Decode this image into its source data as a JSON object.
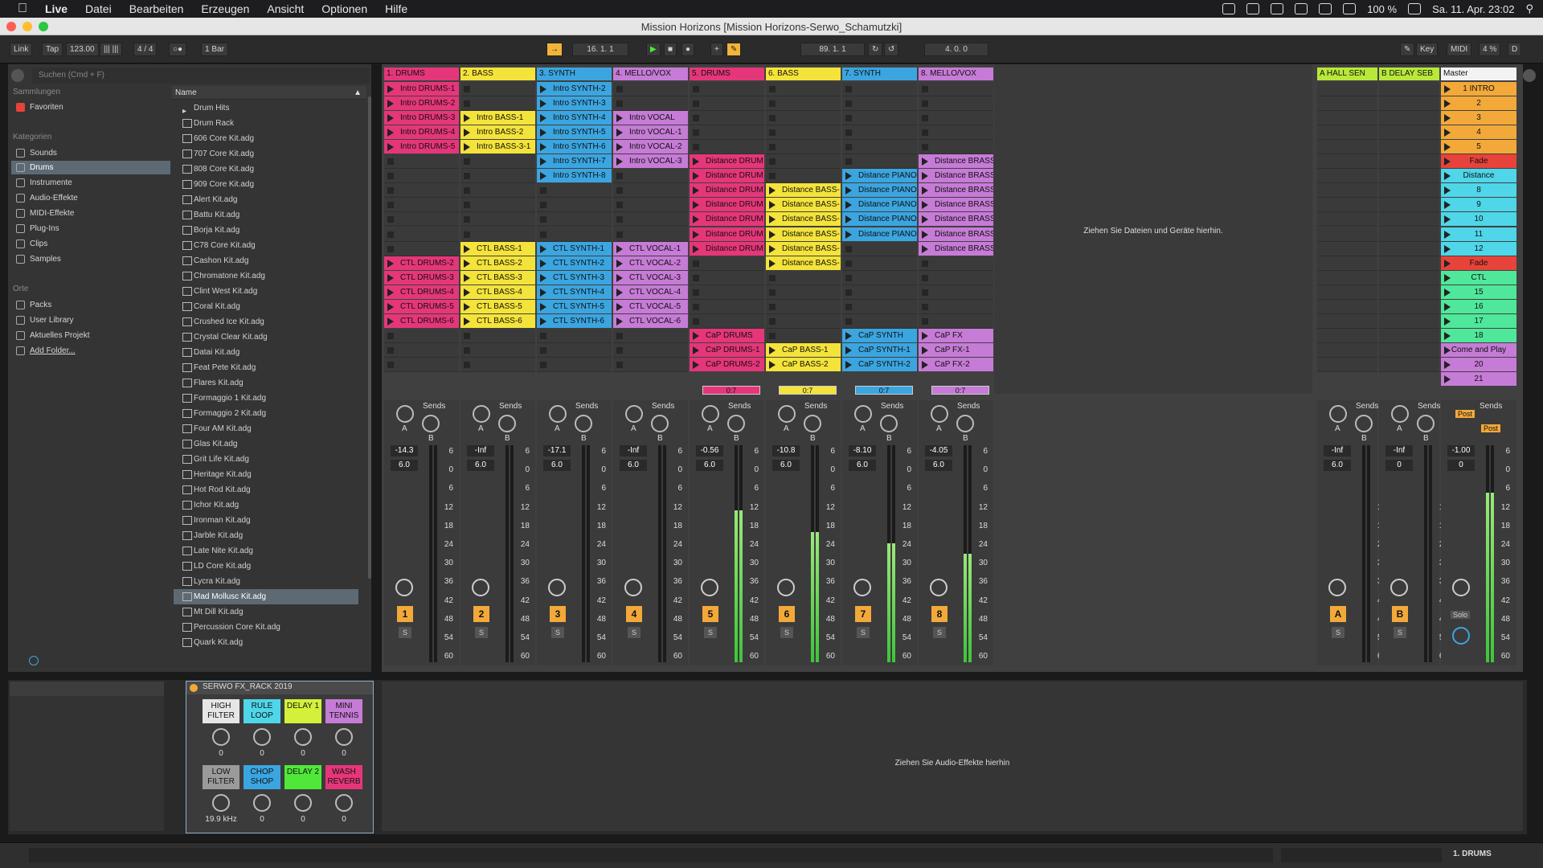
{
  "menubar": {
    "app": "Live",
    "items": [
      "Datei",
      "Bearbeiten",
      "Erzeugen",
      "Ansicht",
      "Optionen",
      "Hilfe"
    ],
    "battery": "100 %",
    "clock": "Sa. 11. Apr.  23:02"
  },
  "window": {
    "title": "Mission Horizons  [Mission Horizons-Serwo_Schamutzki]"
  },
  "transport": {
    "link": "Link",
    "tap": "Tap",
    "tempo": "123.00",
    "signature": "4 / 4",
    "metro": "○●",
    "quant": "1 Bar",
    "position": "16.   1.   1",
    "loop_start": "89.   1.   1",
    "loop_len": "4.   0.   0",
    "key": "Key",
    "midi": "MIDI",
    "cpu": "4 %",
    "d": "D"
  },
  "browser": {
    "search_placeholder": "Suchen (Cmd + F)",
    "collections_header": "Sammlungen",
    "favorites": "Favoriten",
    "categories_header": "Kategorien",
    "categories": [
      "Sounds",
      "Drums",
      "Instrumente",
      "Audio-Effekte",
      "MIDI-Effekte",
      "Plug-Ins",
      "Clips",
      "Samples"
    ],
    "places_header": "Orte",
    "places": [
      "Packs",
      "User Library",
      "Aktuelles Projekt",
      "Add Folder..."
    ],
    "name_header": "Name",
    "files": [
      "Drum Hits",
      "Drum Rack",
      "606 Core Kit.adg",
      "707 Core Kit.adg",
      "808 Core Kit.adg",
      "909 Core Kit.adg",
      "Alert Kit.adg",
      "Battu Kit.adg",
      "Borja Kit.adg",
      "C78 Core Kit.adg",
      "Cashon Kit.adg",
      "Chromatone Kit.adg",
      "Clint West Kit.adg",
      "Coral Kit.adg",
      "Crushed Ice Kit.adg",
      "Crystal Clear Kit.adg",
      "Datai Kit.adg",
      "Feat Pete Kit.adg",
      "Flares Kit.adg",
      "Formaggio 1 Kit.adg",
      "Formaggio 2 Kit.adg",
      "Four AM Kit.adg",
      "Glas Kit.adg",
      "Grit Life Kit.adg",
      "Heritage Kit.adg",
      "Hot Rod Kit.adg",
      "Ichor Kit.adg",
      "Ironman Kit.adg",
      "Jarble Kit.adg",
      "Late Nite Kit.adg",
      "LD Core Kit.adg",
      "Lycra Kit.adg",
      "Mad Mollusc Kit.adg",
      "Mt Dill Kit.adg",
      "Percussion Core Kit.adg",
      "Quark Kit.adg"
    ]
  },
  "session": {
    "drop_hint": "Ziehen Sie Dateien und Geräte hierhin.",
    "tracks": [
      {
        "name": "1. DRUMS",
        "color": "#e5367a",
        "vol": "-14.3",
        "num": "1",
        "clips": [
          "Intro DRUMS-1",
          "Intro DRUMS-2",
          "Intro DRUMS-3",
          "Intro DRUMS-4",
          "Intro DRUMS-5",
          "",
          "",
          "",
          "",
          "",
          "",
          "",
          "CTL DRUMS-2",
          "CTL DRUMS-3",
          "CTL DRUMS-4",
          "CTL DRUMS-5",
          "CTL DRUMS-6",
          "",
          "",
          ""
        ]
      },
      {
        "name": "2. BASS",
        "color": "#f4e33a",
        "vol": "-Inf",
        "num": "2",
        "clips": [
          "",
          "",
          "Intro BASS-1",
          "Intro BASS-2",
          "Intro BASS-3-1",
          "",
          "",
          "",
          "",
          "",
          "",
          "CTL BASS-1",
          "CTL BASS-2",
          "CTL BASS-3",
          "CTL BASS-4",
          "CTL BASS-5",
          "CTL BASS-6",
          "",
          "",
          ""
        ]
      },
      {
        "name": "3. SYNTH",
        "color": "#3ba5e0",
        "vol": "-17.1",
        "num": "3",
        "clips": [
          "Intro SYNTH-2",
          "Intro SYNTH-3",
          "Intro SYNTH-4",
          "Intro SYNTH-5",
          "Intro SYNTH-6",
          "Intro SYNTH-7",
          "Intro SYNTH-8",
          "",
          "",
          "",
          "",
          "CTL SYNTH-1",
          "CTL SYNTH-2",
          "CTL SYNTH-3",
          "CTL SYNTH-4",
          "CTL SYNTH-5",
          "CTL SYNTH-6",
          "",
          "",
          ""
        ]
      },
      {
        "name": "4. MELLO/VOX",
        "color": "#c67bd6",
        "vol": "-Inf",
        "num": "4",
        "clips": [
          "",
          "",
          "Intro VOCAL",
          "Intro VOCAL-1",
          "Intro VOCAL-2",
          "Intro VOCAL-3",
          "",
          "",
          "",
          "",
          "",
          "CTL VOCAL-1",
          "CTL VOCAL-2",
          "CTL VOCAL-3",
          "CTL VOCAL-4",
          "CTL VOCAL-5",
          "CTL VOCAL-6",
          "",
          "",
          ""
        ]
      },
      {
        "name": "5. DRUMS",
        "color": "#e5367a",
        "vol": "-0.56",
        "num": "5",
        "clips": [
          "",
          "",
          "",
          "",
          "",
          "Distance DRUM",
          "Distance DRUM",
          "Distance DRUM",
          "Distance DRUM",
          "Distance DRUM",
          "Distance DRUM",
          "Distance DRUM",
          "",
          "",
          "",
          "",
          "",
          "CaP DRUMS",
          "CaP DRUMS-1",
          "CaP DRUMS-2"
        ]
      },
      {
        "name": "6. BASS",
        "color": "#f4e33a",
        "vol": "-10.8",
        "num": "6",
        "clips": [
          "",
          "",
          "",
          "",
          "",
          "",
          "",
          "Distance BASS-",
          "Distance BASS-",
          "Distance BASS-",
          "Distance BASS-",
          "Distance BASS-",
          "Distance BASS-",
          "",
          "",
          "",
          "",
          "",
          "CaP BASS-1",
          "CaP BASS-2"
        ]
      },
      {
        "name": "7. SYNTH",
        "color": "#3ba5e0",
        "vol": "-8.10",
        "num": "7",
        "clips": [
          "",
          "",
          "",
          "",
          "",
          "",
          "Distance PIANO",
          "Distance PIANO",
          "Distance PIANO",
          "Distance PIANO",
          "Distance PIANO",
          "",
          "",
          "",
          "",
          "",
          "",
          "CaP SYNTH",
          "CaP SYNTH-1",
          "CaP SYNTH-2"
        ]
      },
      {
        "name": "8. MELLO/VOX",
        "color": "#c67bd6",
        "vol": "-4.05",
        "num": "8",
        "clips": [
          "",
          "",
          "",
          "",
          "",
          "Distance BRASS",
          "Distance BRASS",
          "Distance BRASS",
          "Distance BRASS",
          "Distance BRASS",
          "Distance BRASS",
          "Distance BRASS",
          "",
          "",
          "",
          "",
          "",
          "CaP FX",
          "CaP FX-1",
          "CaP FX-2"
        ]
      }
    ],
    "returns": [
      {
        "name": "A HALL SEN",
        "color": "#b7e83a",
        "vol": "-Inf",
        "num": "A"
      },
      {
        "name": "B DELAY SEB",
        "color": "#b7e83a",
        "vol": "-Inf",
        "num": "B"
      }
    ],
    "master": {
      "name": "Master",
      "vol": "-1.00",
      "solo": "Solo",
      "scenes": [
        {
          "label": "1 INTRO",
          "color": "#f2a93a"
        },
        {
          "label": "2",
          "color": "#f2a93a"
        },
        {
          "label": "3",
          "color": "#f2a93a"
        },
        {
          "label": "4",
          "color": "#f2a93a"
        },
        {
          "label": "5",
          "color": "#f2a93a"
        },
        {
          "label": "Fade",
          "color": "#e8433a"
        },
        {
          "label": "Distance",
          "color": "#4fd6e8"
        },
        {
          "label": "8",
          "color": "#4fd6e8"
        },
        {
          "label": "9",
          "color": "#4fd6e8"
        },
        {
          "label": "10",
          "color": "#4fd6e8"
        },
        {
          "label": "11",
          "color": "#4fd6e8"
        },
        {
          "label": "12",
          "color": "#4fd6e8"
        },
        {
          "label": "Fade",
          "color": "#e8433a"
        },
        {
          "label": "CTL",
          "color": "#4fe89a"
        },
        {
          "label": "15",
          "color": "#4fe89a"
        },
        {
          "label": "16",
          "color": "#4fe89a"
        },
        {
          "label": "17",
          "color": "#4fe89a"
        },
        {
          "label": "18",
          "color": "#4fe89a"
        },
        {
          "label": "Come and Play",
          "color": "#c67bd6"
        },
        {
          "label": "20",
          "color": "#c67bd6"
        },
        {
          "label": "21",
          "color": "#c67bd6"
        }
      ]
    },
    "sends_label": "Sends",
    "send_a": "A",
    "send_b": "B",
    "post": "Post",
    "track_vol2": "6.0",
    "return_a_vol2": "6.0",
    "return_b_vol2": "0",
    "master_vol2": "0",
    "meter_ticks": [
      "6",
      "0",
      "6",
      "12",
      "18",
      "24",
      "30",
      "36",
      "42",
      "48",
      "54",
      "60"
    ],
    "stop_info": "0:7"
  },
  "device": {
    "rack_title": "SERWO FX_RACK 2019",
    "drop_hint": "Ziehen Sie Audio-Effekte hierhin",
    "macros": [
      {
        "label": "HIGH FILTER",
        "color": "#e6e6e6",
        "value": "0"
      },
      {
        "label": "RULE LOOP",
        "color": "#4fd6e8",
        "value": "0"
      },
      {
        "label": "DELAY 1",
        "color": "#d4f03a",
        "value": "0"
      },
      {
        "label": "MINI TENNIS",
        "color": "#c67bd6",
        "value": "0"
      },
      {
        "label": "LOW FILTER",
        "color": "#9a9a9a",
        "value": "19.9 kHz"
      },
      {
        "label": "CHOP SHOP",
        "color": "#3ba5e0",
        "value": "0"
      },
      {
        "label": "DELAY 2",
        "color": "#4fe83a",
        "value": "0"
      },
      {
        "label": "WASH REVERB",
        "color": "#e5367a",
        "value": "0"
      }
    ]
  },
  "status": {
    "selected_track": "1. DRUMS"
  }
}
